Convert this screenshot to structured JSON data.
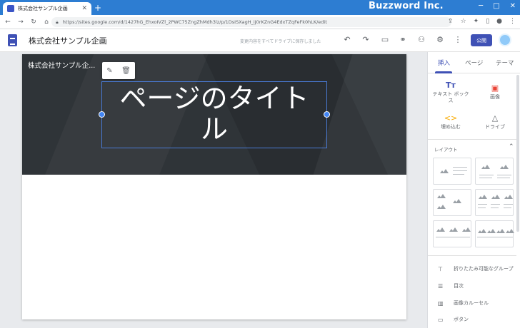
{
  "browser": {
    "tab_title": "株式会社サンプル企画",
    "brand": "Buzzword Inc.",
    "url": "https://sites.google.com/d/1427hG_EhxoIVZl_2PWC75ZngZhMdh3lz/p/1DsISXagH_iJ0rKZnG4EdxTZqFeFk0hLK/edit"
  },
  "header": {
    "site_name": "株式会社サンプル企画",
    "save_status": "変更内容をすべてドライブに保存しました",
    "publish_label": "公開"
  },
  "banner": {
    "site_label": "株式会社サンプル企...",
    "page_title_line1": "ページのタイト",
    "page_title_line2": "ル"
  },
  "panel": {
    "tabs": [
      "挿入",
      "ページ",
      "テーマ"
    ],
    "insert_tools": [
      {
        "label_line1": "テキスト ボック",
        "label_line2": "ス",
        "icon": "text-box-icon"
      },
      {
        "label_line1": "画像",
        "label_line2": "",
        "icon": "image-icon"
      },
      {
        "label_line1": "埋め込む",
        "label_line2": "",
        "icon": "embed-icon"
      },
      {
        "label_line1": "ドライブ",
        "label_line2": "",
        "icon": "drive-icon"
      }
    ],
    "layout_header": "レイアウト",
    "components": [
      {
        "label": "折りたたみ可能なグループ",
        "icon": "collapsible-group-icon"
      },
      {
        "label": "目次",
        "icon": "table-of-contents-icon"
      },
      {
        "label": "画像カルーセル",
        "icon": "image-carousel-icon"
      },
      {
        "label": "ボタン",
        "icon": "button-icon"
      }
    ]
  },
  "colors": {
    "accent": "#3f51b5",
    "browser_bar": "#2d7dd2",
    "banner": "#2f3438",
    "selection": "#4a7bd6"
  }
}
